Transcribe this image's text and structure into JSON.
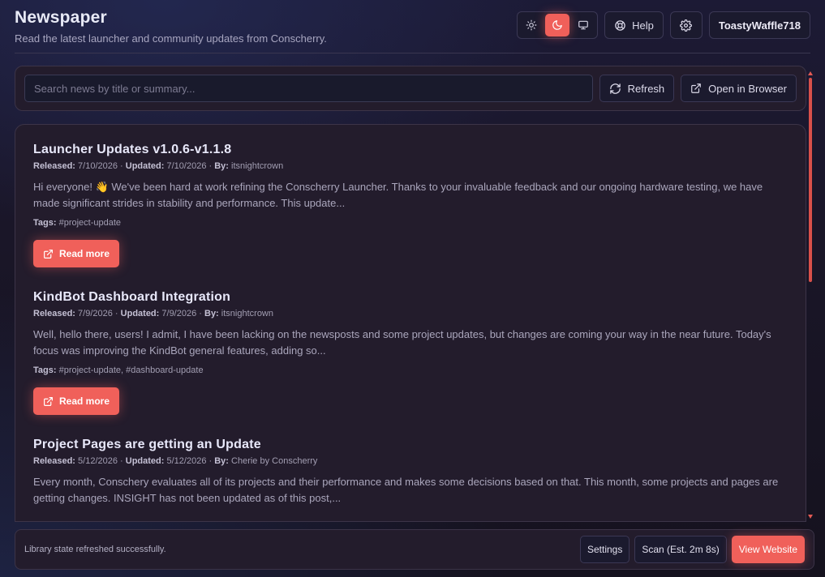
{
  "header": {
    "title": "Newspaper",
    "subtitle": "Read the latest launcher and community updates from Conscherry."
  },
  "top_controls": {
    "theme_options": [
      "light",
      "dark",
      "system"
    ],
    "theme_active": "dark",
    "help_label": "Help",
    "username": "ToastyWaffle718"
  },
  "search": {
    "placeholder": "Search news by title or summary...",
    "value": "",
    "refresh_label": "Refresh",
    "open_browser_label": "Open in Browser"
  },
  "labels": {
    "released": "Released:",
    "updated": "Updated:",
    "by": "By:",
    "tags": "Tags:",
    "read_more": "Read more",
    "sep": " · "
  },
  "news": [
    {
      "title": "Launcher Updates v1.0.6-v1.1.8",
      "released": "7/10/2026",
      "updated": "7/10/2026",
      "author": "itsnightcrown",
      "summary": "Hi everyone! 👋 We've been hard at work refining the Conscherry Launcher. Thanks to your invaluable feedback and our ongoing hardware testing, we have made significant strides in stability and performance. This update...",
      "tags": "#project-update"
    },
    {
      "title": "KindBot Dashboard Integration",
      "released": "7/9/2026",
      "updated": "7/9/2026",
      "author": "itsnightcrown",
      "summary": "Well, hello there, users! I admit, I have been lacking on the newsposts and some project updates, but changes are coming your way in the near future. Today's focus was improving the KindBot general features, adding so...",
      "tags": "#project-update, #dashboard-update"
    },
    {
      "title": "Project Pages are getting an Update",
      "released": "5/12/2026",
      "updated": "5/12/2026",
      "author": "Cherie by Conscherry",
      "summary": "Every month, Conschery evaluates all of its projects and their performance and makes some decisions based on that. This month, some projects and pages are getting changes. INSIGHT has not been updated as of this post,...",
      "tags": ""
    }
  ],
  "status": {
    "message": "Library state refreshed successfully.",
    "settings_label": "Settings",
    "scan_label": "Scan (Est. 2m 8s)",
    "view_website_label": "View Website"
  },
  "colors": {
    "accent": "#f0605a",
    "panel": "#231c2c",
    "button": "#1b1a2e"
  }
}
